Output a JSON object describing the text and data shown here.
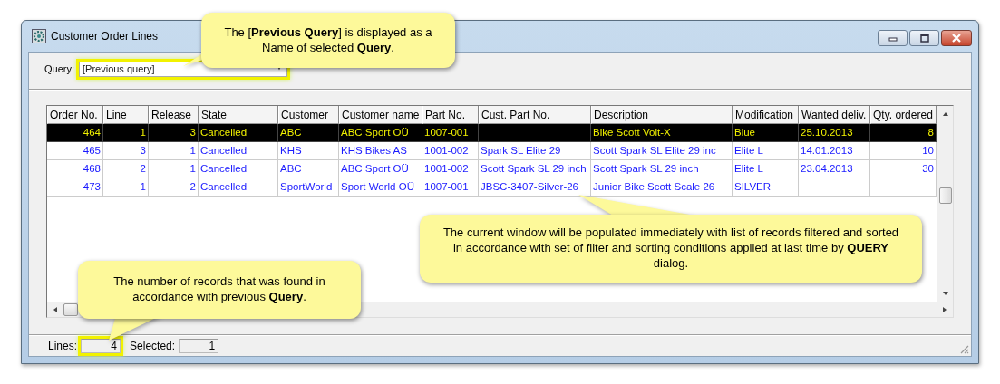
{
  "window": {
    "title": "Customer Order Lines"
  },
  "query": {
    "label": "Query:",
    "value": "[Previous query]",
    "highlighted": true
  },
  "table": {
    "columns": [
      {
        "label": "Order No.",
        "kind": "number"
      },
      {
        "label": "Line",
        "kind": "number"
      },
      {
        "label": "Release",
        "kind": "number"
      },
      {
        "label": "State",
        "kind": "text"
      },
      {
        "label": "Customer",
        "kind": "text"
      },
      {
        "label": "Customer name",
        "kind": "text"
      },
      {
        "label": "Part No.",
        "kind": "text"
      },
      {
        "label": "Cust. Part No.",
        "kind": "text"
      },
      {
        "label": "Description",
        "kind": "text"
      },
      {
        "label": "Modification",
        "kind": "text"
      },
      {
        "label": "Wanted deliv.",
        "kind": "text"
      },
      {
        "label": "Qty. ordered",
        "kind": "number"
      }
    ],
    "rows": [
      {
        "selected": true,
        "cells": [
          "464",
          "1",
          "3",
          "Cancelled",
          "ABC",
          "ABC Sport OÜ",
          "1007-001",
          "",
          "Bike Scott Volt-X",
          "Blue",
          "25.10.2013",
          "8"
        ]
      },
      {
        "selected": false,
        "cells": [
          "465",
          "3",
          "1",
          "Cancelled",
          "KHS",
          "KHS Bikes AS",
          "1001-002",
          "Spark SL Elite 29",
          "Scott Spark SL Elite 29 inc",
          "Elite L",
          "14.01.2013",
          "10"
        ]
      },
      {
        "selected": false,
        "cells": [
          "468",
          "2",
          "1",
          "Cancelled",
          "ABC",
          "ABC Sport OÜ",
          "1001-002",
          "Scott Spark SL 29 inch",
          "Scott Spark SL 29 inch",
          "Elite L",
          "23.04.2013",
          "30"
        ]
      },
      {
        "selected": false,
        "cells": [
          "473",
          "1",
          "2",
          "Cancelled",
          "SportWorld",
          "Sport World OÜ",
          "1007-001",
          "JBSC-3407-Silver-26",
          "Junior Bike Scott Scale 26",
          "SILVER",
          "",
          ""
        ]
      }
    ]
  },
  "status_bar": {
    "lines_label": "Lines:",
    "lines_value": "4",
    "lines_highlighted": true,
    "selected_label": "Selected:",
    "selected_value": "1"
  },
  "callouts": [
    {
      "kind": "query",
      "text": "The [**Previous Query**] is displayed as a Name of selected **Query**."
    },
    {
      "kind": "window",
      "text": "The current window will be populated immediately with list of records filtered and sorted in accordance with set of filter and sorting conditions applied at last time by **QUERY** dialog."
    },
    {
      "kind": "lines",
      "text": "The number of records that was found in accordance with previous **Query**."
    }
  ]
}
